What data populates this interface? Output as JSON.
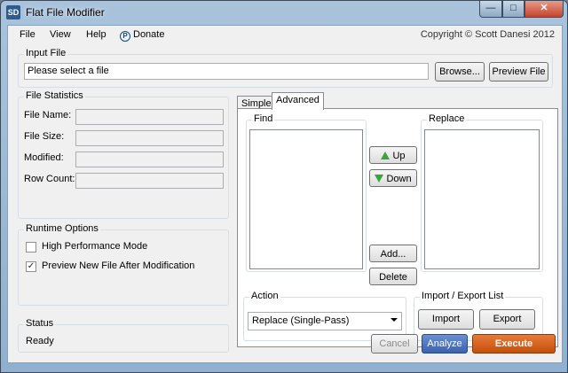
{
  "window": {
    "title": "Flat File Modifier",
    "app_icon": "SD",
    "caption_minimize": "—",
    "caption_maximize": "□",
    "caption_close": "✕"
  },
  "menu": {
    "items": [
      {
        "label": "File"
      },
      {
        "label": "View"
      },
      {
        "label": "Help"
      }
    ],
    "donate": {
      "icon": "P",
      "label": "Donate"
    },
    "copyright": "Copyright © Scott Danesi 2012"
  },
  "input_file": {
    "group_label": "Input File",
    "value": "Please select a file",
    "browse_label": "Browse...",
    "preview_label": "Preview File"
  },
  "file_statistics": {
    "group_label": "File Statistics",
    "fields": [
      {
        "label": "File Name:",
        "value": ""
      },
      {
        "label": "File Size:",
        "value": ""
      },
      {
        "label": "Modified:",
        "value": ""
      },
      {
        "label": "Row Count:",
        "value": ""
      }
    ]
  },
  "runtime_options": {
    "group_label": "Runtime Options",
    "options": [
      {
        "label": "High Performance Mode",
        "checked": false,
        "mark": ""
      },
      {
        "label": "Preview New File After Modification",
        "checked": true,
        "mark": "✓"
      }
    ]
  },
  "status": {
    "group_label": "Status",
    "value": "Ready"
  },
  "tabs": [
    {
      "label": "Simple",
      "active": false
    },
    {
      "label": "Advanced",
      "active": true
    }
  ],
  "advanced": {
    "find_label": "Find",
    "replace_label": "Replace",
    "up_label": "Up",
    "down_label": "Down",
    "add_label": "Add...",
    "delete_label": "Delete",
    "action": {
      "group_label": "Action",
      "selected": "Replace (Single-Pass)"
    },
    "import_export": {
      "group_label": "Import / Export List",
      "import_label": "Import",
      "export_label": "Export"
    }
  },
  "footer": {
    "cancel_label": "Cancel",
    "analyze_label": "Analyze",
    "execute_label": "Execute"
  }
}
